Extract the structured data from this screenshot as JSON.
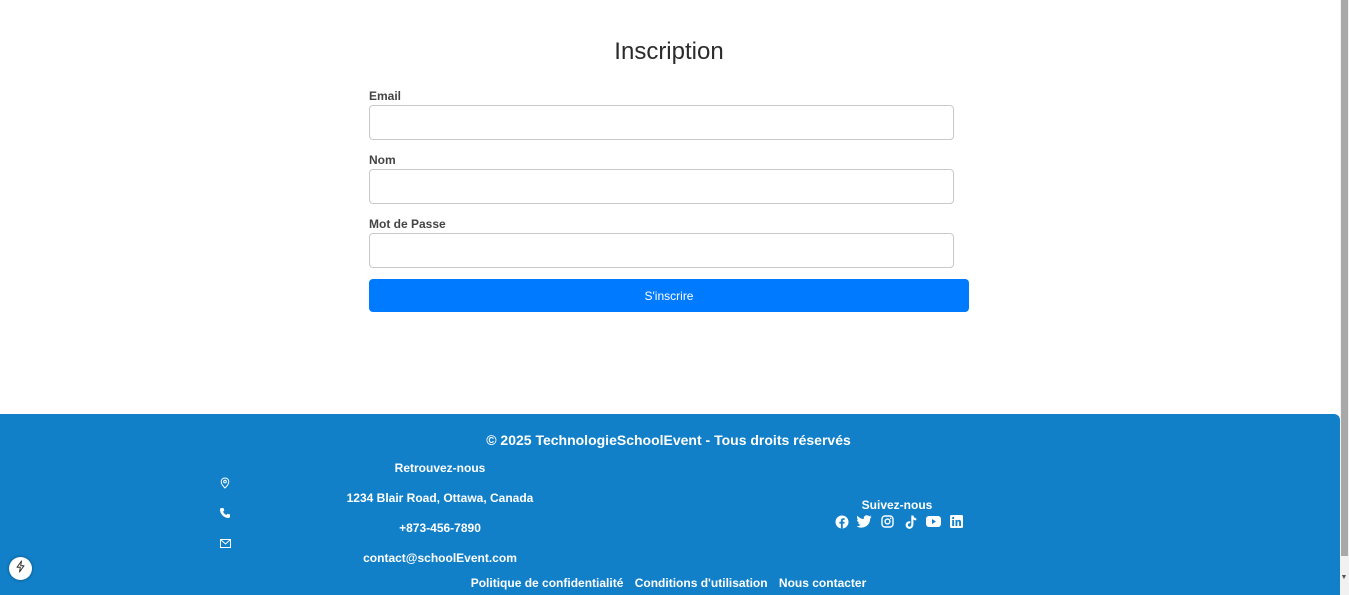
{
  "form": {
    "title": "Inscription",
    "fields": [
      {
        "label": "Email",
        "value": "",
        "placeholder": ""
      },
      {
        "label": "Nom",
        "value": "",
        "placeholder": ""
      },
      {
        "label": "Mot de Passe",
        "value": "",
        "placeholder": ""
      }
    ],
    "submit_label": "S'inscrire"
  },
  "footer": {
    "copyright": "© 2025 TechnologieSchoolEvent - Tous droits réservés",
    "contact": {
      "heading": "Retrouvez-nous",
      "address": "1234 Blair Road, Ottawa, Canada",
      "phone": "+873-456-7890",
      "email": "contact@schoolEvent.com"
    },
    "follow": {
      "heading": "Suivez-nous",
      "icons": [
        "facebook-icon",
        "twitter-icon",
        "instagram-icon",
        "tiktok-icon",
        "youtube-icon",
        "linkedin-icon"
      ]
    },
    "links": [
      "Politique de confidentialité",
      "Conditions d'utilisation",
      "Nous contacter"
    ]
  },
  "colors": {
    "primary_button": "#007bff",
    "footer_bg": "#1180c8"
  }
}
